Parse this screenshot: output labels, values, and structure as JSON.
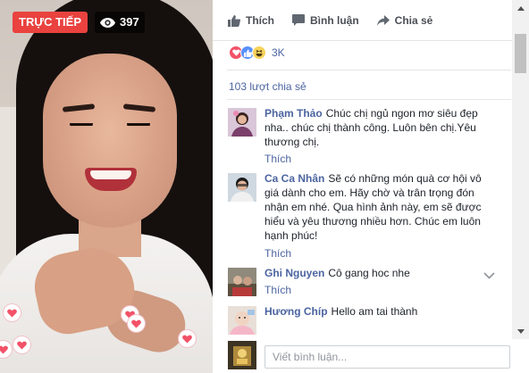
{
  "live": {
    "badge": "TRỰC TIẾP",
    "viewers": "397",
    "badge_color": "#e9423f"
  },
  "actions": {
    "like": "Thích",
    "comment": "Bình luận",
    "share": "Chia sẻ"
  },
  "reactions": {
    "types": [
      "love-icon",
      "like-icon",
      "haha-icon"
    ],
    "count": "3K"
  },
  "shares": "103 lượt chia sẻ",
  "comments": [
    {
      "name": "Phạm Thảo",
      "text": "Chúc chị ngủ ngon mơ siêu đẹp nha.. chúc chị thành công. Luôn bên chị.Yêu thương chị.",
      "action": "Thích"
    },
    {
      "name": "Ca Ca Nhân",
      "text": "Sẽ có những món quà cơ hội vô giá dành cho em. Hãy chờ và trân trọng đón nhận em nhé. Qua hình ảnh này, em sẽ được hiểu và yêu thương nhiều hơn. Chúc em luôn hạnh phúc!",
      "action": "Thích"
    },
    {
      "name": "Ghi Nguyen",
      "text": "Cô gang hoc nhe",
      "action": "Thích"
    },
    {
      "name": "Hương Chíp",
      "text": "Hello am tai thành",
      "action": ""
    }
  ],
  "composer": {
    "placeholder": "Viết bình luận..."
  },
  "colors": {
    "link": "#4b64a0",
    "live_red": "#e9423f",
    "love": "#f25268",
    "like": "#5890ff"
  }
}
